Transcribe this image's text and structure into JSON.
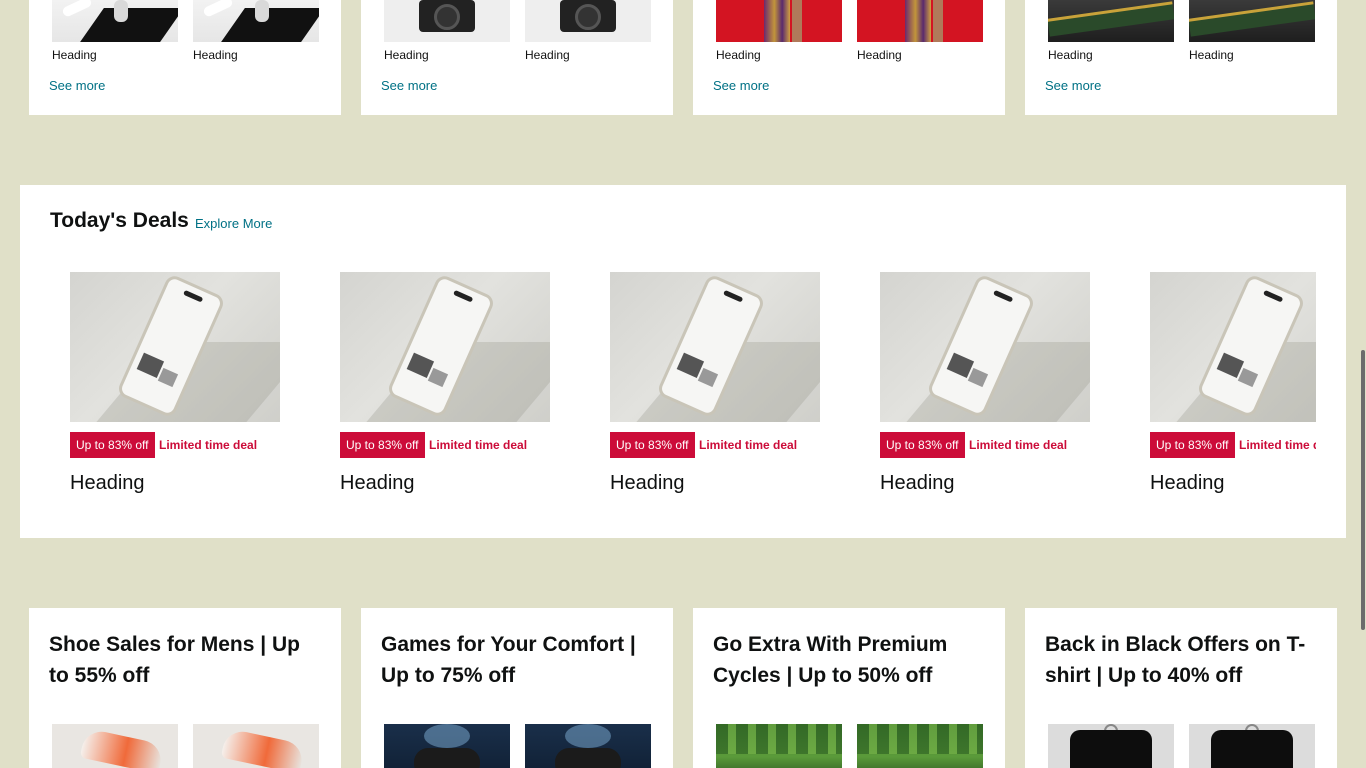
{
  "top_cards": [
    {
      "thumb_type": "figurine",
      "labels": [
        "Heading",
        "Heading"
      ],
      "see_more": "See more"
    },
    {
      "thumb_type": "camera",
      "labels": [
        "Heading",
        "Heading"
      ],
      "see_more": "See more"
    },
    {
      "thumb_type": "saree",
      "labels": [
        "Heading",
        "Heading"
      ],
      "see_more": "See more"
    },
    {
      "thumb_type": "ram",
      "labels": [
        "Heading",
        "Heading"
      ],
      "see_more": "See more"
    }
  ],
  "deals": {
    "title": "Today's Deals",
    "explore": "Explore More",
    "items": [
      {
        "badge": "Up to 83% off",
        "limited": "Limited time deal",
        "heading": "Heading"
      },
      {
        "badge": "Up to 83% off",
        "limited": "Limited time deal",
        "heading": "Heading"
      },
      {
        "badge": "Up to 83% off",
        "limited": "Limited time deal",
        "heading": "Heading"
      },
      {
        "badge": "Up to 83% off",
        "limited": "Limited time deal",
        "heading": "Heading"
      },
      {
        "badge": "Up to 83% off",
        "limited": "Limited time deal",
        "heading": "Heading"
      }
    ]
  },
  "promos": [
    {
      "title": "Shoe Sales for Mens | Up to 55% off",
      "thumb_type": "shoe"
    },
    {
      "title": "Games for Your Comfort | Up to 75% off",
      "thumb_type": "game"
    },
    {
      "title": "Go Extra With Premium Cycles | Up to 50% off",
      "thumb_type": "cycle"
    },
    {
      "title": "Back in Black Offers on T-shirt | Up to 40% off",
      "thumb_type": "tshirt"
    }
  ],
  "colors": {
    "background": "#e0e0c8",
    "link": "#007185",
    "deal_red": "#cc0c39"
  }
}
